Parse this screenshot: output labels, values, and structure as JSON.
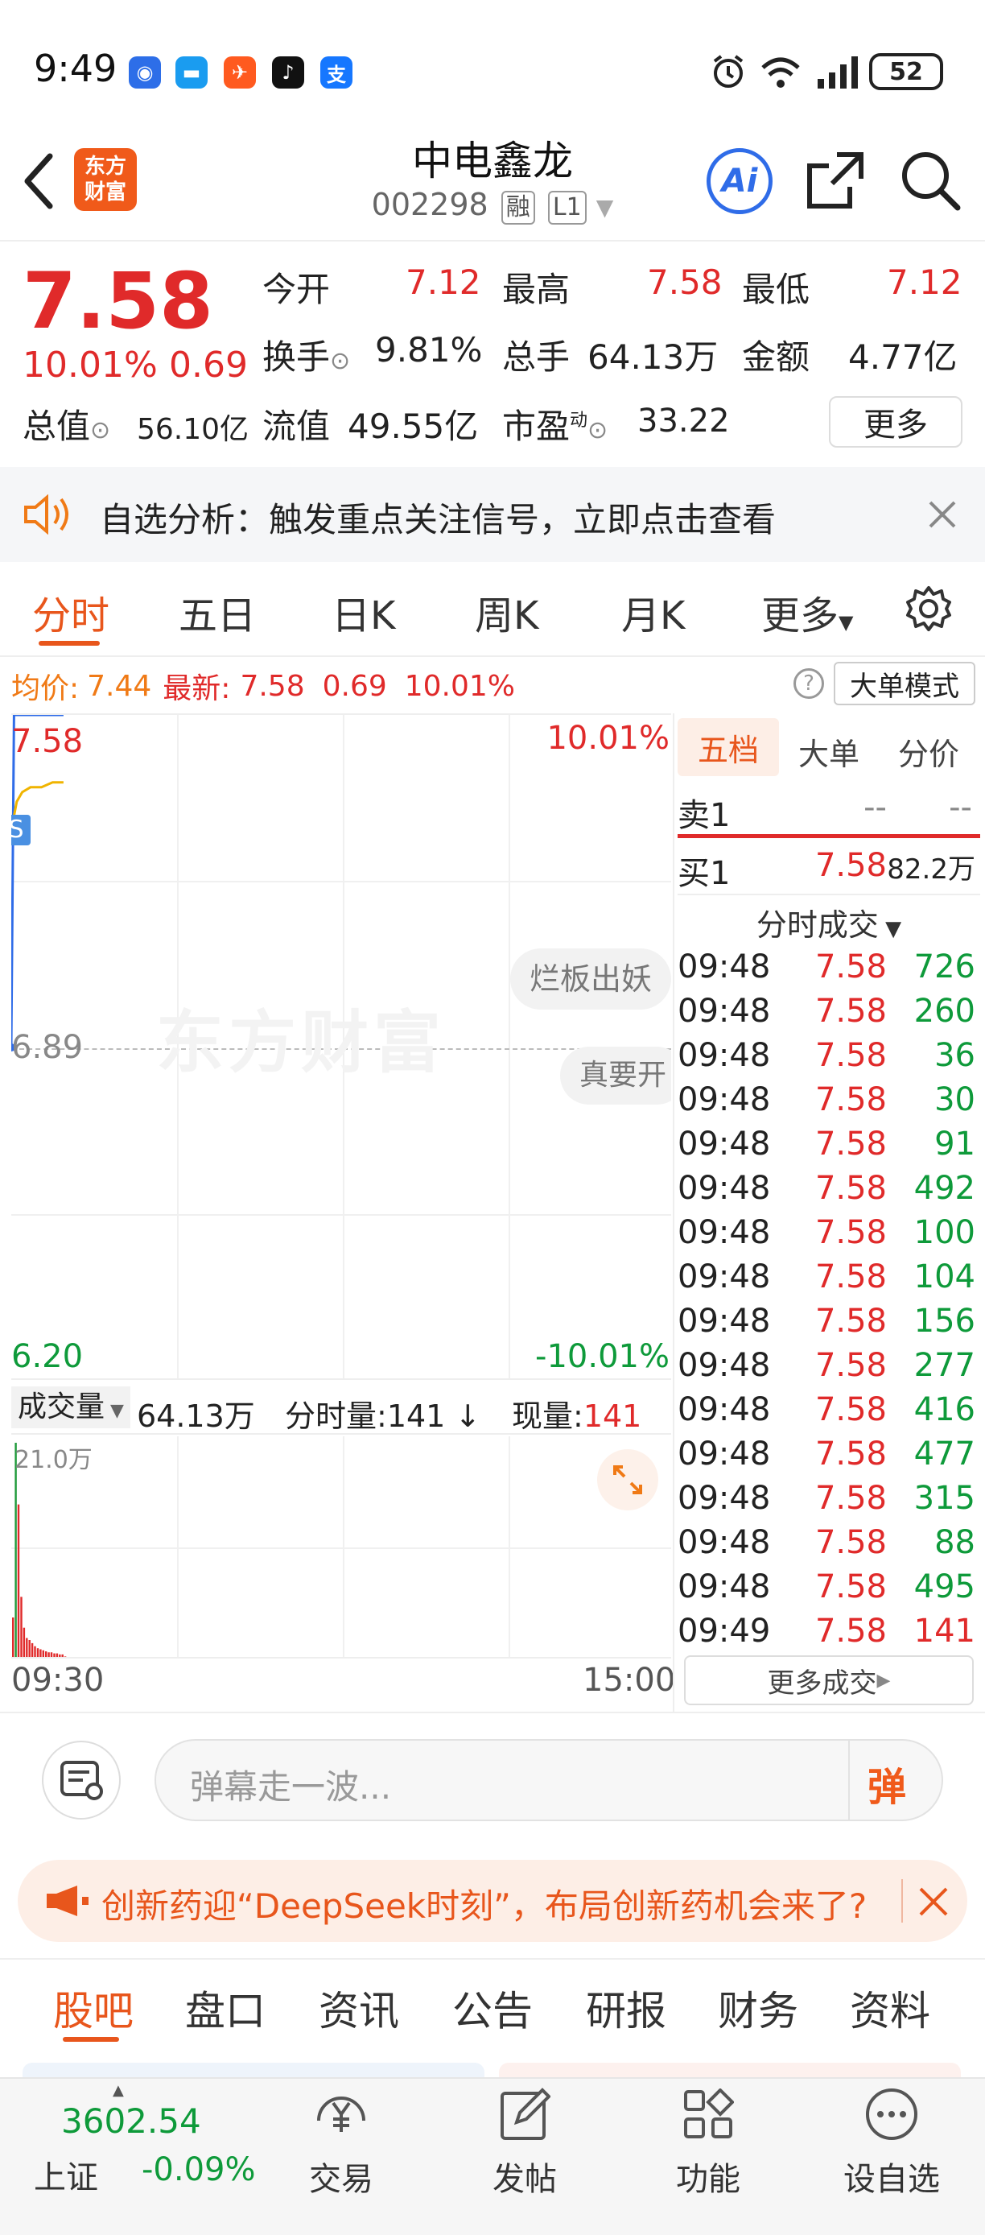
{
  "status_bar": {
    "time": "9:49",
    "battery": "52",
    "app_icons": [
      "rocket-app",
      "chat-app",
      "flyer-app",
      "tiktok-app",
      "alipay-app"
    ],
    "alipay_glyph": "支"
  },
  "header": {
    "logo_line1": "东方",
    "logo_line2": "财富",
    "title": "中电鑫龙",
    "code": "002298",
    "tag_margin": "融",
    "tag_level": "L1",
    "ai_label": "Ai"
  },
  "quote": {
    "price": "7.58",
    "change_pct": "10.01%",
    "change_abs": "0.69",
    "open_label": "今开",
    "open": "7.12",
    "high_label": "最高",
    "high": "7.58",
    "low_label": "最低",
    "low": "7.12",
    "turnover_label": "换手",
    "turnover": "9.81%",
    "volume_label": "总手",
    "volume": "64.13万",
    "amount_label": "金额",
    "amount": "4.77亿",
    "mktcap_label": "总值",
    "mktcap": "56.10亿",
    "float_label": "流值",
    "float": "49.55亿",
    "pe_label": "市盈",
    "pe_sup": "动",
    "pe": "33.22",
    "more_label": "更多"
  },
  "alert": {
    "text": "自选分析：触发重点关注信号，立即点击查看"
  },
  "tabs": [
    "分时",
    "五日",
    "日K",
    "周K",
    "月K",
    "更多"
  ],
  "chart_info": {
    "avg_label": "均价:",
    "avg": "7.44",
    "latest_label": "最新:",
    "latest": "7.58",
    "latest_chg": "0.69",
    "latest_pct": "10.01%",
    "mode_btn": "大单模式",
    "y_top": "7.58",
    "y_mid": "6.89",
    "y_bot": "6.20",
    "pct_top": "10.01%",
    "pct_bot": "-10.01%",
    "watermark": "东方财富",
    "danmu1": "烂板出妖",
    "danmu2": "真要开",
    "s_marker": "S",
    "vol_label": "成交量",
    "vol_total": "64.13万",
    "tick_vol_label": "分时量:",
    "tick_vol": "141",
    "now_vol_label": "现量:",
    "now_vol": "141",
    "vol_max": "21.0万",
    "x_start": "09:30",
    "x_end": "15:00"
  },
  "chart_data": {
    "type": "line",
    "title": "",
    "series": [
      {
        "x": [
          "09:30",
          "09:31",
          "09:33",
          "09:36",
          "09:40",
          "09:45",
          "09:48",
          "09:49"
        ],
        "values": [
          6.89,
          7.58,
          7.58,
          7.58,
          7.58,
          7.58,
          7.58,
          7.58
        ]
      },
      {
        "x": [
          "09:31",
          "09:32",
          "09:34",
          "09:37",
          "09:41",
          "09:45",
          "09:49"
        ],
        "values": [
          7.37,
          7.4,
          7.42,
          7.43,
          7.43,
          7.44,
          7.44
        ]
      }
    ],
    "ylim": [
      6.2,
      7.58
    ],
    "xlim": [
      "09:30",
      "15:00"
    ],
    "volume": {
      "x": [
        "09:30",
        "09:31",
        "09:32",
        "09:33",
        "09:34",
        "09:35",
        "09:36",
        "09:37",
        "09:38",
        "09:39",
        "09:40",
        "09:41",
        "09:42",
        "09:43",
        "09:44",
        "09:45",
        "09:46",
        "09:47",
        "09:48",
        "09:49"
      ],
      "values": [
        4.0,
        21.0,
        15.0,
        6.0,
        3.0,
        2.0,
        1.8,
        1.5,
        1.2,
        1.0,
        0.9,
        0.8,
        0.7,
        0.6,
        0.6,
        0.5,
        0.5,
        0.4,
        0.4,
        0.2
      ],
      "ylim": [
        0,
        21.0
      ]
    }
  },
  "order_book": {
    "tabs": [
      "五档",
      "大单",
      "分价"
    ],
    "sell1_label": "卖1",
    "sell1_price": "--",
    "sell1_vol": "--",
    "buy1_label": "买1",
    "buy1_price": "7.58",
    "buy1_vol": "82.2万",
    "ticks_header": "分时成交",
    "more_trades": "更多成交",
    "trades": [
      {
        "t": "09:48",
        "p": "7.58",
        "v": "726"
      },
      {
        "t": "09:48",
        "p": "7.58",
        "v": "260"
      },
      {
        "t": "09:48",
        "p": "7.58",
        "v": "36"
      },
      {
        "t": "09:48",
        "p": "7.58",
        "v": "30"
      },
      {
        "t": "09:48",
        "p": "7.58",
        "v": "91"
      },
      {
        "t": "09:48",
        "p": "7.58",
        "v": "492"
      },
      {
        "t": "09:48",
        "p": "7.58",
        "v": "100"
      },
      {
        "t": "09:48",
        "p": "7.58",
        "v": "104"
      },
      {
        "t": "09:48",
        "p": "7.58",
        "v": "156"
      },
      {
        "t": "09:48",
        "p": "7.58",
        "v": "277"
      },
      {
        "t": "09:48",
        "p": "7.58",
        "v": "416"
      },
      {
        "t": "09:48",
        "p": "7.58",
        "v": "477"
      },
      {
        "t": "09:48",
        "p": "7.58",
        "v": "315"
      },
      {
        "t": "09:48",
        "p": "7.58",
        "v": "88"
      },
      {
        "t": "09:48",
        "p": "7.58",
        "v": "495"
      },
      {
        "t": "09:49",
        "p": "7.58",
        "v": "141"
      }
    ]
  },
  "comment_bar": {
    "placeholder": "弹幕走一波...",
    "send_label": "弹"
  },
  "news_banner": {
    "text": "创新药迎“DeepSeek时刻”，布局创新药机会来了?"
  },
  "sub_tabs": [
    "股吧",
    "盘口",
    "资讯",
    "公告",
    "研报",
    "财务",
    "资料"
  ],
  "bottom_nav": {
    "index_value": "3602.54",
    "index_name": "上证",
    "index_change": "-0.09%",
    "items": [
      "交易",
      "发帖",
      "功能",
      "设自选"
    ]
  }
}
